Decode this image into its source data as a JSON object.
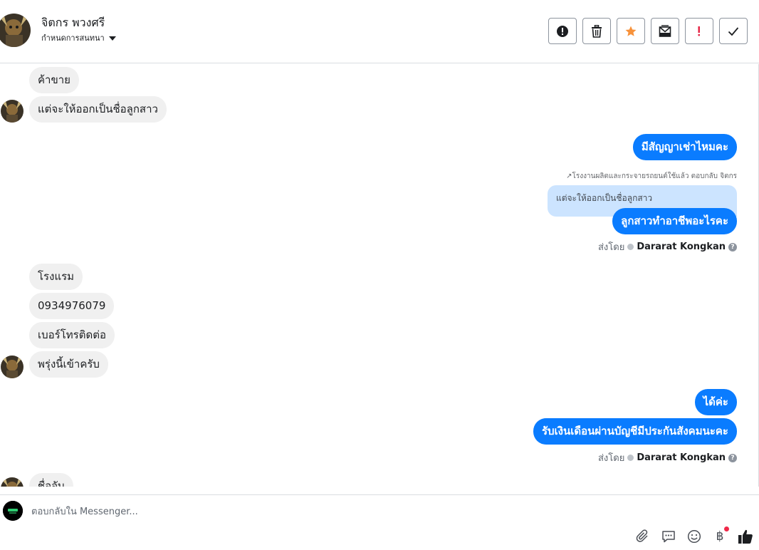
{
  "header": {
    "name": "จิตกร พวงศรี",
    "subtitle": "กำหนดการสนทนา",
    "actions": [
      {
        "name": "spam-button",
        "icon": "alert-circle-icon"
      },
      {
        "name": "delete-button",
        "icon": "trash-icon"
      },
      {
        "name": "star-button",
        "icon": "star-icon"
      },
      {
        "name": "mark-unread-button",
        "icon": "envelope-x-icon"
      },
      {
        "name": "priority-button",
        "icon": "exclamation-icon"
      },
      {
        "name": "done-button",
        "icon": "check-icon"
      }
    ]
  },
  "messages": {
    "in1": "ค้าขาย",
    "in2": "แต่จะให้ออกเป็นชื่อลูกสาว",
    "out1": "มีสัญญาเช่าไหมคะ",
    "reply_note": "โรงงานผลิตและกระจายรถยนต์ใช้แล้ว ตอบกลับ จิตกร",
    "quoted": "แต่จะให้ออกเป็นชื่อลูกสาว",
    "out2": "ลูกสาวทำอาชีพอะไรคะ",
    "sent_by_label": "ส่งโดย",
    "sent_by_name": "Dararat Kongkan",
    "in3": "โรงแรม",
    "in4": "0934976079",
    "in5": "เบอร์โทรติดต่อ",
    "in6": "พรุ่งนี้เข้าครับ",
    "out3": "ได้ค่ะ",
    "out4": "รับเงินเดือนผ่านบัญชีมีประกันสังคมนะคะ",
    "sent_by_label2": "ส่งโดย",
    "sent_by_name2": "Dararat Kongkan",
    "in7": "ชื่อจับ"
  },
  "composer": {
    "placeholder": "ตอบกลับใน Messenger...",
    "baht": "฿"
  },
  "colors": {
    "outgoing": "#0a7cff",
    "incoming": "#f0f0f0",
    "quoted": "#cce4ff",
    "star": "#f7923b",
    "priority": "#e41e3f"
  }
}
